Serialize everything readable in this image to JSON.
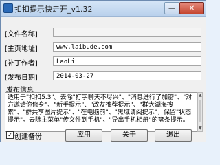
{
  "window": {
    "title": "扣扣提示快走开_v1.32",
    "minimize_glyph": "—",
    "close_glyph": "✕"
  },
  "fields": {
    "file_name": {
      "label": "[文件名称]",
      "value": ""
    },
    "homepage": {
      "label": "[主页地址]",
      "value": "www.laibude.com"
    },
    "author": {
      "label": "[补丁作者]",
      "value": "LaoLi"
    },
    "release_date": {
      "label": "[发布日期]",
      "value": "2014-03-27"
    }
  },
  "description": {
    "label": "发布信息",
    "text": "适用于\"扣扣5.3\"。去除\"打字聊天不尽兴\"、\"消息进行了加密\"、\"对方邀请你修身\"、\"新手提示\"、\"改友推荐提示\"、\"群大湖海搜索\"、\"群共享图片提示\"、\"在电脑前\"、\"黑域请阅提示\"，保留\"状态提示\"。去除主菜单\"传文件到手机\"、\"导出手机相册\"的篮条提示。"
  },
  "backup": {
    "label": "创建备份",
    "checked": true,
    "check_glyph": "✓"
  },
  "buttons": {
    "apply": "应用",
    "about": "关于",
    "exit": "退出"
  },
  "scroll": {
    "up": "▲",
    "down": "▼"
  }
}
